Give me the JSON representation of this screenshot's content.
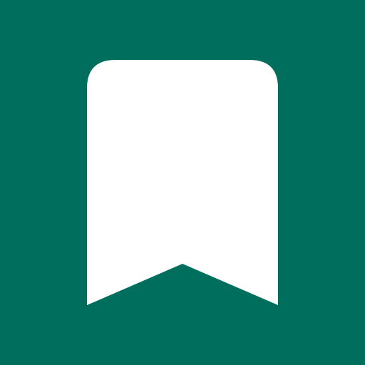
{
  "icon": {
    "name": "bookmark-icon",
    "background_color": "#006E5C",
    "glyph_color": "#FFFFFF"
  }
}
